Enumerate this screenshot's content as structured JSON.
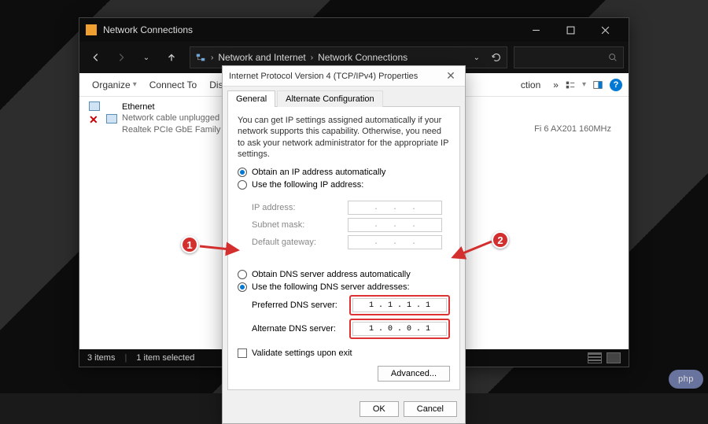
{
  "window": {
    "title": "Network Connections",
    "breadcrumb_root": "Network and Internet",
    "breadcrumb_current": "Network Connections"
  },
  "toolbar": {
    "organize": "Organize",
    "connect": "Connect To",
    "disable": "Disable",
    "connection_trunc": "ction",
    "more": "»"
  },
  "adapters": {
    "ethernet": {
      "name": "Ethernet",
      "status": "Network cable unplugged",
      "device": "Realtek PCIe GbE Family Contr..."
    },
    "wifi": {
      "device_trunc": "Fi 6 AX201 160MHz"
    }
  },
  "status": {
    "items": "3 items",
    "selected": "1 item selected"
  },
  "dialog": {
    "title": "Internet Protocol Version 4 (TCP/IPv4) Properties",
    "tab_general": "General",
    "tab_alt": "Alternate Configuration",
    "info": "You can get IP settings assigned automatically if your network supports this capability. Otherwise, you need to ask your network administrator for the appropriate IP settings.",
    "opt_auto_ip": "Obtain an IP address automatically",
    "opt_use_ip": "Use the following IP address:",
    "lbl_ip": "IP address:",
    "lbl_subnet": "Subnet mask:",
    "lbl_gateway": "Default gateway:",
    "opt_auto_dns": "Obtain DNS server address automatically",
    "opt_use_dns": "Use the following DNS server addresses:",
    "lbl_pref_dns": "Preferred DNS server:",
    "lbl_alt_dns": "Alternate DNS server:",
    "pref_dns_value": "1 . 1 . 1 . 1",
    "alt_dns_value": "1 . 0 . 0 . 1",
    "validate": "Validate settings upon exit",
    "advanced": "Advanced...",
    "ok": "OK",
    "cancel": "Cancel"
  },
  "annotations": {
    "b1": "1",
    "b2": "2"
  },
  "watermark": "php"
}
